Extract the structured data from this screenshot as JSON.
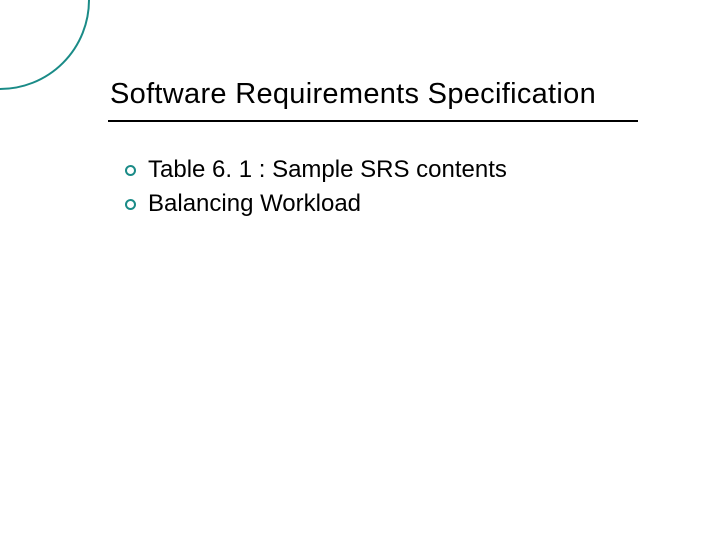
{
  "slide": {
    "title": "Software Requirements Specification",
    "bullets": [
      {
        "text": "Table 6. 1 : Sample SRS contents"
      },
      {
        "text": "Balancing Workload"
      }
    ]
  },
  "colors": {
    "accent": "#1a8b87"
  }
}
